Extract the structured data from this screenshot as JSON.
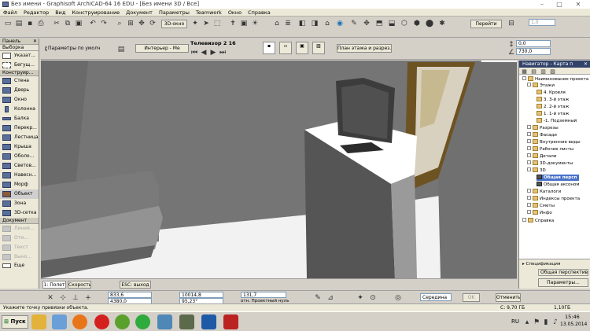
{
  "window": {
    "title": "Без имени - Graphisoft ArchiCAD-64 16 EDU - [Без имени 3D / Все]",
    "controls": [
      "–",
      "□",
      "✕"
    ]
  },
  "menu": [
    "Файл",
    "Редактор",
    "Вид",
    "Конструирование",
    "Документ",
    "Параметры",
    "Teamwork",
    "Окно",
    "Справка"
  ],
  "toolbar": {
    "view3d_label": "3D-окно",
    "go_label": "Перейти",
    "params_label": "Параметры по умолч.",
    "interior_label": "Интерьер - Ме",
    "object_name": "Телевизор 2 16",
    "floorplan_label": "План этажа и разрез...",
    "value_a": "1,0",
    "value_b": "0,0",
    "value_c": "730,0"
  },
  "left_panel": {
    "header": "Панель",
    "selection_header": "Выборка",
    "items_top": [
      "Указат...",
      "Бегущ..."
    ],
    "construct_header": "Конструир...",
    "items": [
      "Стена",
      "Дверь",
      "Окно",
      "Колонна",
      "Балка",
      "Перекр...",
      "Лестница",
      "Крыша",
      "Оболо...",
      "Светов...",
      "Навесн...",
      "Морф",
      "Объект",
      "Зона",
      "3D-сетка"
    ],
    "selected": "Объект",
    "document_header": "Документ",
    "items_doc": [
      "Линей...",
      "Отм...",
      "Текст",
      "Выно...",
      "Еще"
    ]
  },
  "navigator": {
    "title": "Навигатор - Карта п",
    "tree": [
      {
        "label": "Наименование проекта",
        "level": 0
      },
      {
        "label": "Этажи",
        "level": 1
      },
      {
        "label": "4. Кровля",
        "level": 2
      },
      {
        "label": "3. 3-й этаж",
        "level": 2
      },
      {
        "label": "2. 2-й этаж",
        "level": 2
      },
      {
        "label": "1. 1-й этаж",
        "level": 2
      },
      {
        "label": "-1. Подземный",
        "level": 2
      },
      {
        "label": "Разрезы",
        "level": 1
      },
      {
        "label": "Фасади",
        "level": 1
      },
      {
        "label": "Внутренние виды",
        "level": 1
      },
      {
        "label": "Рабочие листы",
        "level": 1
      },
      {
        "label": "Детали",
        "level": 1
      },
      {
        "label": "3D-документы",
        "level": 1
      },
      {
        "label": "3D",
        "level": 1
      },
      {
        "label": "Общая персп",
        "level": 2
      },
      {
        "label": "Общая аксоном",
        "level": 2
      },
      {
        "label": "Каталоги",
        "level": 1
      },
      {
        "label": "Индексы проекта",
        "level": 1
      },
      {
        "label": "Сметы",
        "level": 1
      },
      {
        "label": "Инфо",
        "level": 1
      },
      {
        "label": "Справка",
        "level": 0
      }
    ],
    "spec_label": "Спецификация",
    "persp_label": "Общая перспектива",
    "params_button": "Параметры..."
  },
  "bottom": {
    "tab_view": "1: Полет",
    "tab_speed": "Скорость",
    "esc_hint": "ESC: выход",
    "dx": "833,6",
    "dy": "4380,0",
    "dz": "10014,8",
    "angle": "95,23°",
    "r": "131,7",
    "ref": "отн. Проектный нуль",
    "mode": "Середина",
    "ok": "OK",
    "cancel": "Отменить"
  },
  "status": {
    "hint": "Укажите точку привязки объекта.",
    "disk_c": "C: 9,70 ГБ",
    "mem": "1,10ГБ"
  },
  "taskbar": {
    "start_label": "Пуск",
    "lang": "RU",
    "time": "15:46",
    "date": "13.05.2014"
  },
  "colors": {
    "accent": "#31436a",
    "selection": "#4a73c8",
    "panel": "#ece9d8"
  }
}
